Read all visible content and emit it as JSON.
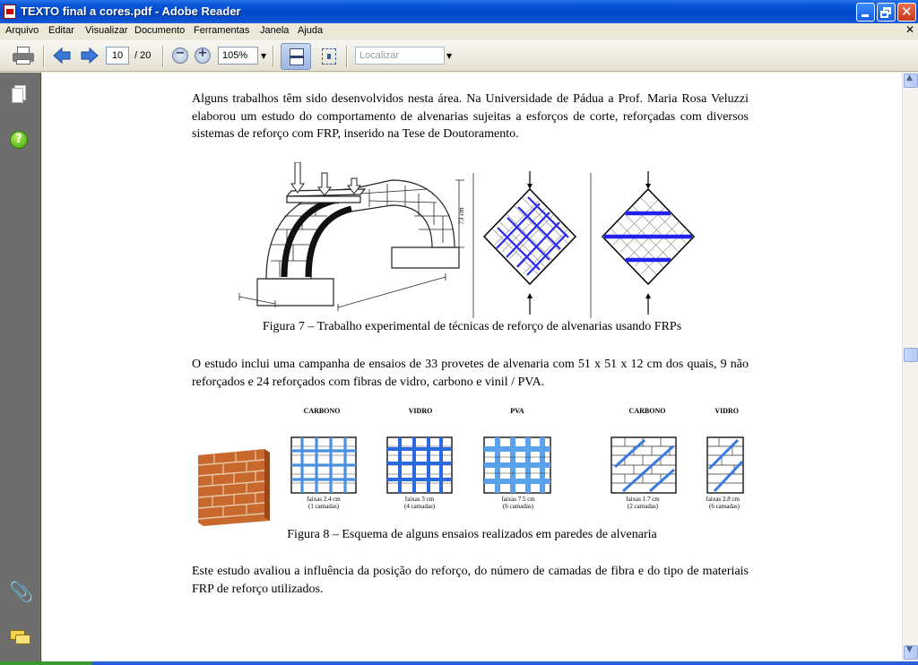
{
  "window": {
    "title": "TEXTO final a cores.pdf - Adobe Reader"
  },
  "menu": [
    "Arquivo",
    "Editar",
    "Visualizar",
    "Documento",
    "Ferramentas",
    "Janela",
    "Ajuda"
  ],
  "toolbar": {
    "current_page": "10",
    "total_pages": "/ 20",
    "zoom": "105%",
    "search_placeholder": "Localizar"
  },
  "document": {
    "para1": "Alguns trabalhos têm sido desenvolvidos nesta área. Na Universidade de Pádua a Prof. Maria Rosa Veluzzi elaborou um estudo do comportamento de alvenarias sujeitas a esforços de corte, reforçadas com diversos sistemas de reforço com FRP, inserido na Tese de Doutoramento.",
    "fig7_caption": "Figura 7 – Trabalho experimental de técnicas de reforço de alvenarias usando FRPs",
    "fig7_labels": {
      "height": "73 cm"
    },
    "para2": "O estudo inclui uma campanha de ensaios de 33 provetes de alvenaria com 51 x 51 x 12 cm dos quais, 9 não reforçados e 24 reforçados com fibras de vidro, carbono e vinil / PVA.",
    "fig8_panels": [
      {
        "title": "CARBONO",
        "strip": "faixas 2.4 cm",
        "layers": "(1 camadas)"
      },
      {
        "title": "VIDRO",
        "strip": "faixas 3 cm",
        "layers": "(4 camadas)"
      },
      {
        "title": "PVA",
        "strip": "faixas 7.5 cm",
        "layers": "(6 camadas)"
      },
      {
        "title": "CARBONO",
        "strip": "faixas  1.7 cm",
        "layers": "(2 camadas)"
      },
      {
        "title": "VIDRO",
        "strip": "faixas 2.8 cm",
        "layers": "(6 camadas)"
      }
    ],
    "fig8_caption": "Figura 8 – Esquema de alguns ensaios realizados em paredes de alvenaria",
    "para3": "Este estudo avaliou a influência da posição do reforço, do número de camadas de fibra e do tipo de materiais FRP de reforço utilizados."
  },
  "colors": {
    "frp_blue": "#2222ee",
    "frp_light_blue": "#4a90e0",
    "brick": "#d2773a",
    "titlebar": "#0a4fd0"
  }
}
